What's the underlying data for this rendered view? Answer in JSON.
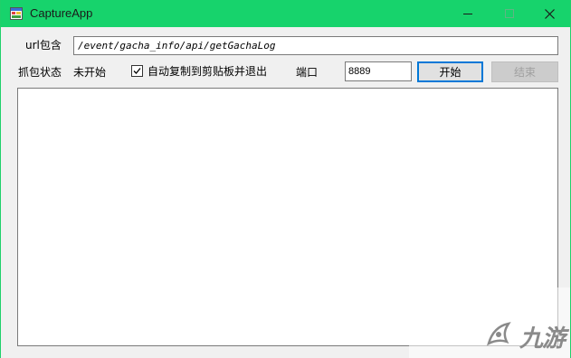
{
  "window": {
    "title": "CaptureApp",
    "title_bar_color": "#17d36c",
    "icon": "app-window-icon"
  },
  "controls": {
    "minimize_icon": "minimize-icon",
    "maximize_icon": "maximize-icon",
    "close_icon": "close-icon"
  },
  "url_filter": {
    "label": "url包含",
    "value": "/event/gacha_info/api/getGachaLog"
  },
  "status": {
    "label": "抓包状态",
    "value": "未开始"
  },
  "auto_copy": {
    "label": "自动复制到剪贴板并退出",
    "checked": true
  },
  "port": {
    "label": "端口",
    "value": "8889"
  },
  "buttons": {
    "start": "开始",
    "stop": "结束",
    "stop_enabled": false
  },
  "log": {
    "content": ""
  },
  "watermark": {
    "text": "九游"
  }
}
